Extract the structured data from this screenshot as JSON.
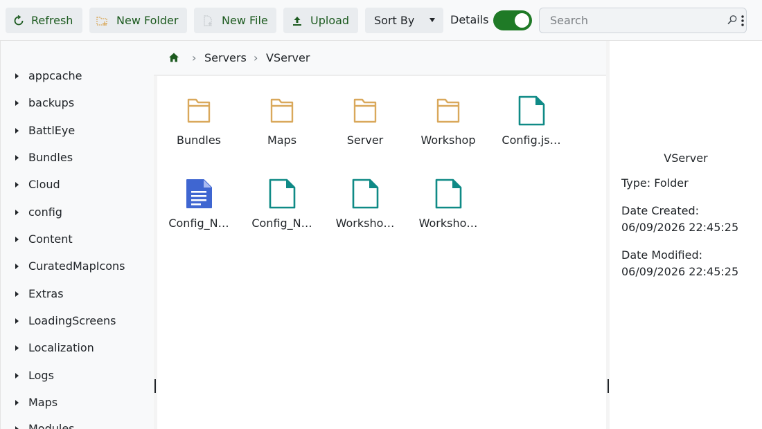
{
  "toolbar": {
    "refresh_label": "Refresh",
    "new_folder_label": "New Folder",
    "new_file_label": "New File",
    "upload_label": "Upload",
    "sort_by_label": "Sort By",
    "details_label": "Details",
    "details_toggle_on": true,
    "search_placeholder": "Search"
  },
  "sidebar": {
    "items": [
      {
        "label": "appcache"
      },
      {
        "label": "backups"
      },
      {
        "label": "BattlEye"
      },
      {
        "label": "Bundles"
      },
      {
        "label": "Cloud"
      },
      {
        "label": "config"
      },
      {
        "label": "Content"
      },
      {
        "label": "CuratedMapIcons"
      },
      {
        "label": "Extras"
      },
      {
        "label": "LoadingScreens"
      },
      {
        "label": "Localization"
      },
      {
        "label": "Logs"
      },
      {
        "label": "Maps"
      },
      {
        "label": "Modules"
      }
    ]
  },
  "breadcrumb": {
    "items": [
      "Servers",
      "VServer"
    ],
    "separator": "›"
  },
  "files": [
    {
      "name": "Bundles",
      "icon": "folder-icon"
    },
    {
      "name": "Maps",
      "icon": "folder-icon"
    },
    {
      "name": "Server",
      "icon": "folder-icon"
    },
    {
      "name": "Workshop",
      "icon": "folder-icon"
    },
    {
      "name": "Config.js…",
      "icon": "file-icon"
    },
    {
      "name": "Config_N…",
      "icon": "document-icon"
    },
    {
      "name": "Config_N…",
      "icon": "file-icon"
    },
    {
      "name": "Worksho…",
      "icon": "file-icon"
    },
    {
      "name": "Worksho…",
      "icon": "file-icon"
    }
  ],
  "details": {
    "title": "VServer",
    "type": "Type: Folder",
    "date_created_label": "Date Created:",
    "date_created": "06/09/2026 22:45:25",
    "date_modified_label": "Date Modified:",
    "date_modified": "06/09/2026 22:45:25"
  },
  "colors": {
    "accent": "#1f7a26",
    "folder": "#d9a85b",
    "file": "#0f8a86",
    "document": "#3f66d1"
  }
}
